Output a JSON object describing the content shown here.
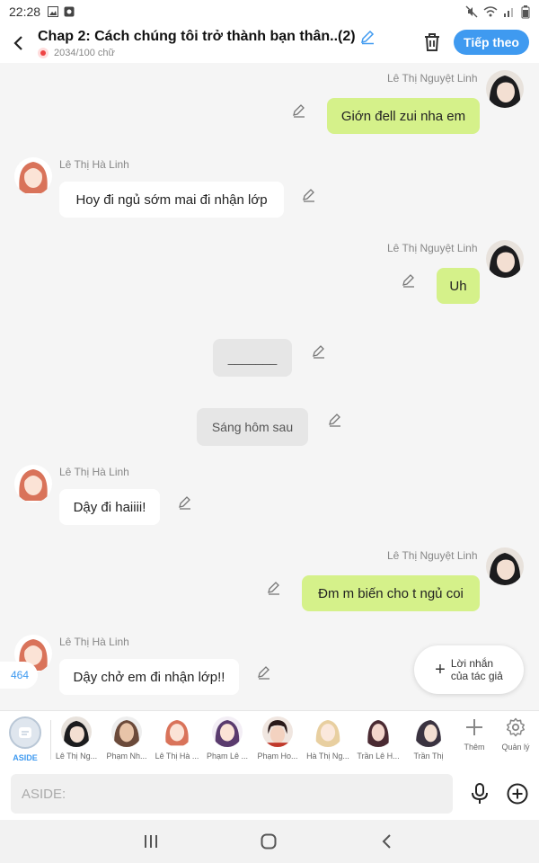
{
  "status": {
    "time": "22:28"
  },
  "header": {
    "title": "Chap 2: Cách chúng tôi trở thành bạn thân..(2)",
    "word_count": "2034/100 chữ",
    "next_label": "Tiếp theo"
  },
  "messages": [
    {
      "side": "right",
      "name": "Lê Thị Nguyệt Linh",
      "text": "Giớn đell zui nha em"
    },
    {
      "side": "left",
      "name": "Lê Thị Hà Linh",
      "text": "Hoy đi ngủ sớm mai đi nhận lớp"
    },
    {
      "side": "right",
      "name": "Lê Thị Nguyệt Linh",
      "text": "Uh"
    },
    {
      "side": "center",
      "text": "_______"
    },
    {
      "side": "center",
      "text": "Sáng hôm sau"
    },
    {
      "side": "left",
      "name": "Lê Thị Hà Linh",
      "text": "Dậy đi haiiii!"
    },
    {
      "side": "right",
      "name": "Lê Thị Nguyệt Linh",
      "text": "Đm m biến cho t ngủ coi"
    },
    {
      "side": "left",
      "name": "Lê Thị Hà Linh",
      "text": "Dậy chở em đi nhận lớp!!"
    }
  ],
  "author_note": {
    "line1": "Lời nhắn",
    "line2": "của tác giả"
  },
  "count_badge": "464",
  "characters": [
    {
      "label": "ASIDE",
      "kind": "aside"
    },
    {
      "label": "Lê Thị Ng...",
      "kind": "dark-hair"
    },
    {
      "label": "Phạm Nh...",
      "kind": "brown-hair"
    },
    {
      "label": "Lê Thị Hà ...",
      "kind": "red-hair"
    },
    {
      "label": "Phạm Lê ...",
      "kind": "purple-hair"
    },
    {
      "label": "Phạm Ho...",
      "kind": "dark-short"
    },
    {
      "label": "Hà Thị Ng...",
      "kind": "blonde-hair"
    },
    {
      "label": "Trần Lê H...",
      "kind": "dark-long"
    },
    {
      "label": "Trần Thị",
      "kind": "dark-side"
    }
  ],
  "tools": {
    "more_label": "Thêm",
    "manage_label": "Quản lý"
  },
  "input": {
    "placeholder": "ASIDE:"
  }
}
